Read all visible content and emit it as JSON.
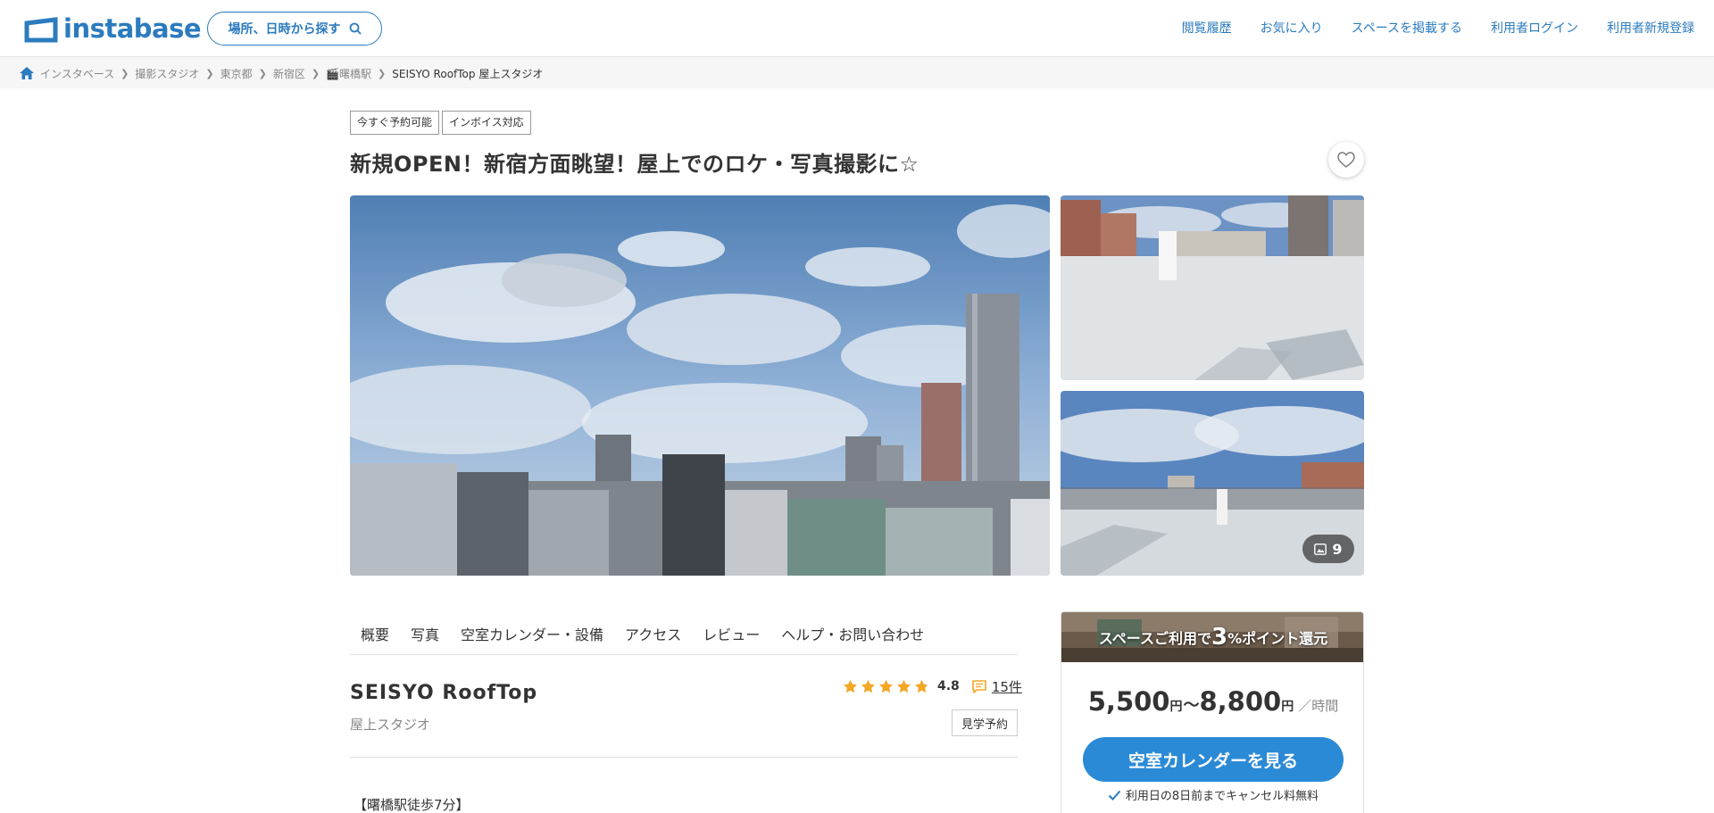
{
  "header": {
    "logo_text": "instabase",
    "search_label": "場所、日時から探す",
    "nav": [
      "閲覧履歴",
      "お気に入り",
      "スペースを掲載する",
      "利用者ログイン",
      "利用者新規登録"
    ]
  },
  "breadcrumb": [
    "インスタベース",
    "撮影スタジオ",
    "東京都",
    "新宿区",
    "🎬曙橋駅",
    "SEISYO RoofTop 屋上スタジオ"
  ],
  "tags": [
    "今すぐ予約可能",
    "インボイス対応"
  ],
  "title": "新規OPEN！新宿方面眺望！屋上でのロケ・写真撮影に☆",
  "gallery": {
    "photo_count": "9"
  },
  "tabs": [
    "概要",
    "写真",
    "空室カレンダー・設備",
    "アクセス",
    "レビュー",
    "ヘルプ・お問い合わせ"
  ],
  "space": {
    "name": "SEISYO RoofTop",
    "type": "屋上スタジオ",
    "rating": "4.8",
    "rating_stars": 4.8,
    "review_count": "15件",
    "tour_button": "見学予約",
    "access_note": "【曙橋駅徒歩7分】"
  },
  "price_card": {
    "banner_prefix": "スペースご利用で",
    "banner_number": "3",
    "banner_suffix": "%ポイント還元",
    "price_min": "5,500",
    "price_max": "8,800",
    "currency": "円",
    "tilde": "～",
    "per": "／時間",
    "calendar_button": "空室カレンダーを見る",
    "cancel_note": "利用日の8日前までキャンセル料無料"
  },
  "colors": {
    "brand": "#2b7bbf",
    "button": "#2b8ad6",
    "star": "#f5a623"
  }
}
